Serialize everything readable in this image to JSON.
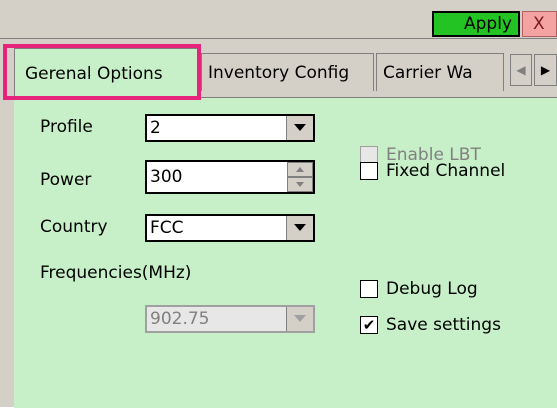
{
  "toolbar": {
    "apply_label": "Apply",
    "close_label": "X"
  },
  "tabs": [
    {
      "label": "Gerenal Options",
      "active": true
    },
    {
      "label": "Inventory Config",
      "active": false
    },
    {
      "label": "Carrier Wa",
      "active": false
    }
  ],
  "tab_scroll": {
    "left": "◀",
    "right": "▶"
  },
  "form": {
    "profile": {
      "label": "Profile",
      "value": "2"
    },
    "power": {
      "label": "Power",
      "value": "300"
    },
    "country": {
      "label": "Country",
      "value": "FCC"
    },
    "frequencies": {
      "label": "Frequencies(MHz)",
      "value": "902.75",
      "enabled": false
    }
  },
  "checkboxes": {
    "enable_lbt": {
      "label": "Enable LBT",
      "checked": false,
      "enabled": false
    },
    "fixed_channel": {
      "label": "Fixed Channel",
      "checked": false,
      "enabled": true
    },
    "debug_log": {
      "label": "Debug Log",
      "checked": false,
      "enabled": true
    },
    "save_settings": {
      "label": "Save settings",
      "checked": true,
      "enabled": true,
      "mark": "✔"
    }
  },
  "colors": {
    "panel": "#c8f0c8",
    "apply": "#22c322",
    "highlight": "#e6247b"
  }
}
